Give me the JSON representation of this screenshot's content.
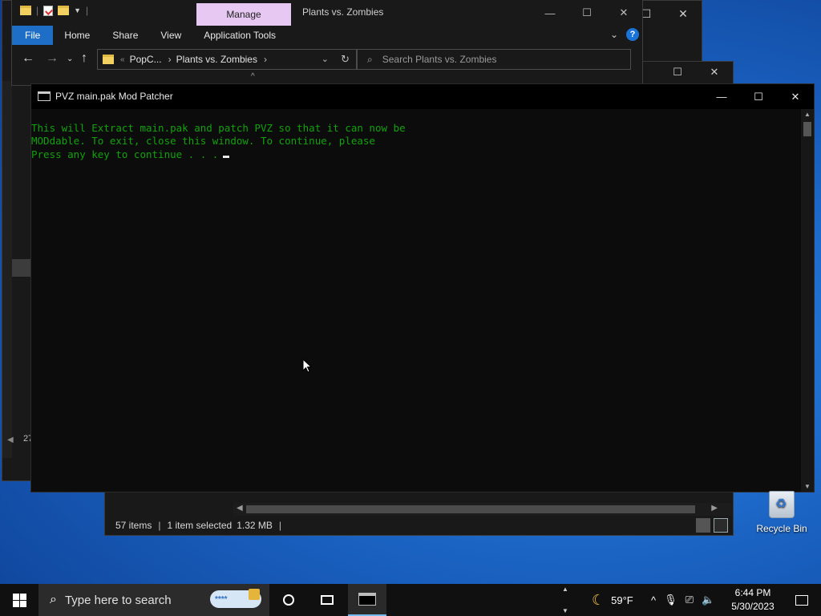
{
  "explorer_back": {
    "item_count_partial": "27"
  },
  "explorer_front": {
    "manage_tab": "Manage",
    "title": "Plants vs. Zombies",
    "ribbon_tabs": [
      "File",
      "Home",
      "Share",
      "View",
      "Application Tools"
    ],
    "address": {
      "crumb_1": "PopC...",
      "crumb_2": "Plants vs. Zombies"
    },
    "search_placeholder": "Search Plants vs. Zombies",
    "help_label": "?"
  },
  "explorer_mid": {
    "status": {
      "items": "57 items",
      "selected": "1 item selected",
      "size": "1.32 MB"
    }
  },
  "console": {
    "title": "PVZ main.pak Mod Patcher",
    "lines": [
      "This will Extract main.pak and patch PVZ so that it can now be",
      "MODdable. To exit, close this window. To continue, please",
      "Press any key to continue . . ."
    ]
  },
  "desktop": {
    "recycle_bin": "Recycle Bin"
  },
  "taskbar": {
    "search_placeholder": "Type here to search",
    "password_badge": "****",
    "weather": "59°F",
    "time": "6:44 PM",
    "date": "5/30/2023"
  },
  "colors": {
    "console_text": "#13a10e",
    "file_tab": "#1e6ec8",
    "manage_tab": "#e6c8f2",
    "taskbar": "#101010"
  }
}
